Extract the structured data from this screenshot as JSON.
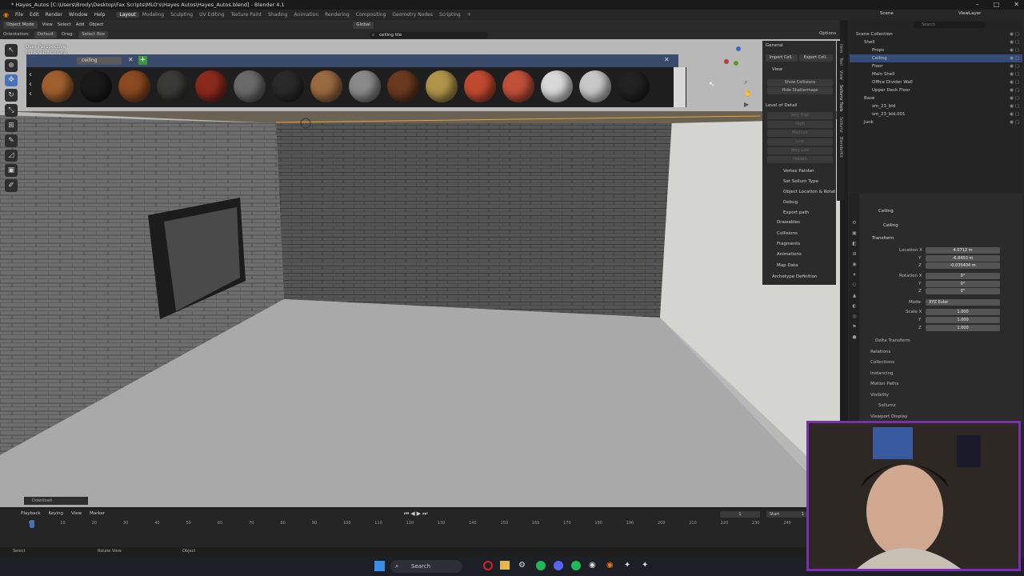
{
  "window": {
    "title": "* Hayes_Autos [C:\\Users\\Brody\\Desktop\\Fax Scripts\\MLO's\\Hayes Autos\\Hayes_Autos.blend] - Blender 4.1",
    "controls": [
      "–",
      "□",
      "✕"
    ]
  },
  "menubar": {
    "menus": [
      "File",
      "Edit",
      "Render",
      "Window",
      "Help"
    ],
    "workspaces": [
      "Layout",
      "Modeling",
      "Sculpting",
      "UV Editing",
      "Texture Paint",
      "Shading",
      "Animation",
      "Rendering",
      "Compositing",
      "Geometry Nodes",
      "Scripting"
    ],
    "active_workspace": "Layout",
    "add_tab": "+"
  },
  "header": {
    "mode": "Object Mode",
    "menus": [
      "View",
      "Select",
      "Add",
      "Object"
    ],
    "orientation_label": "Orientation:",
    "orientation_value": "Default",
    "drag_label": "Drag:",
    "drag_value": "Select Box",
    "transform": "Global",
    "options": "Options"
  },
  "search": {
    "value": "ceiling tile"
  },
  "viewport": {
    "perspective": "User Perspective",
    "collection": "(1) Shell | Ceiling",
    "palette_search": "ceiling",
    "download_label": "Download"
  },
  "materials": [
    {
      "name": "copper-ball",
      "color": "#a0602e"
    },
    {
      "name": "black-ball",
      "color": "#1a1a1a"
    },
    {
      "name": "rust-ball",
      "color": "#8a4a22"
    },
    {
      "name": "dark-metal-ball",
      "color": "#3a3a36"
    },
    {
      "name": "red-ball",
      "color": "#8a2a1c"
    },
    {
      "name": "gray-tile-ball",
      "color": "#6a6a6a"
    },
    {
      "name": "charcoal-ball",
      "color": "#2a2a2a"
    },
    {
      "name": "wood-slat-ball",
      "color": "#9a6a40"
    },
    {
      "name": "gray-panel-ball",
      "color": "#8a8a8a"
    },
    {
      "name": "brown-wood-ball",
      "color": "#6a3a20"
    },
    {
      "name": "gold-hex-ball",
      "color": "#b0944a"
    },
    {
      "name": "red-brick-ball",
      "color": "#c04a30"
    },
    {
      "name": "red-tile-ball",
      "color": "#c0503a"
    },
    {
      "name": "white-ball",
      "color": "#d8d8d8"
    },
    {
      "name": "white-hex-ball",
      "color": "#c8c8c8"
    },
    {
      "name": "black-gloss-ball",
      "color": "#222222"
    }
  ],
  "npanel": {
    "general": "General",
    "import_btn": "Import Coll..",
    "export_btn": "Export Coll..",
    "view": "View",
    "show_collisions": "Show Collisions",
    "hide_shattermaps": "Hide Shattermaps",
    "lod": "Level of Detail",
    "lod_items": [
      "Very High",
      "High",
      "Medium",
      "Low",
      "Very Low",
      "Hidden"
    ],
    "subpanels": [
      "Vertex Painter",
      "Set Sollum Type",
      "Object Location & Rotat..",
      "Debug",
      "Export path"
    ],
    "sections": [
      "Drawables",
      "Collisions",
      "Fragments",
      "Animations",
      "Map Data",
      "Archetype Definition"
    ],
    "tabs": [
      "Item",
      "Tool",
      "View",
      "Sollumz Tools",
      "Sollumz",
      "BlenderKit"
    ]
  },
  "outliner": {
    "search_placeholder": "Search",
    "scene": "Scene",
    "viewlayer": "ViewLayer",
    "items": [
      {
        "label": "Scene Collection",
        "indent": 0
      },
      {
        "label": "Shell",
        "indent": 1
      },
      {
        "label": "Props",
        "indent": 2
      },
      {
        "label": "Ceiling",
        "indent": 2
      },
      {
        "label": "Floor",
        "indent": 2
      },
      {
        "label": "Main Shell",
        "indent": 2
      },
      {
        "label": "Office Divider Wall",
        "indent": 2
      },
      {
        "label": "Upper Deck Floor",
        "indent": 2
      },
      {
        "label": "Base",
        "indent": 1
      },
      {
        "label": "sm_23_bld",
        "indent": 2
      },
      {
        "label": "sm_23_bld.001",
        "indent": 2
      },
      {
        "label": "Junk",
        "indent": 1
      }
    ]
  },
  "properties": {
    "object": "Ceiling",
    "object_name": "Ceiling",
    "transform": "Transform",
    "location_label": "Location X",
    "loc_x": "4.0712 m",
    "loc_y": "-6.8453 m",
    "loc_z": "-0.035404 m",
    "rotation_label": "Rotation X",
    "rot_x": "0°",
    "rot_y": "0°",
    "rot_z": "0°",
    "mode_label": "Mode",
    "mode_value": "XYZ Euler",
    "scale_label": "Scale X",
    "scale_x": "1.000",
    "scale_y": "1.000",
    "scale_z": "1.000",
    "y": "Y",
    "z": "Z",
    "sections": [
      "Delta Transform",
      "Relations",
      "Collections",
      "Instancing",
      "Motion Paths",
      "Visibility",
      "Sollumz",
      "Viewport Display"
    ]
  },
  "timeline": {
    "menus": [
      "Playback",
      "Keying",
      "View",
      "Marker"
    ],
    "current_frame": "1",
    "start_label": "Start",
    "start": "1",
    "ticks": [
      "0",
      "10",
      "20",
      "30",
      "40",
      "50",
      "60",
      "70",
      "80",
      "90",
      "100",
      "110",
      "120",
      "130",
      "140",
      "150",
      "160",
      "170",
      "180",
      "190",
      "200",
      "210",
      "220",
      "230",
      "240"
    ]
  },
  "statusbar": {
    "select": "Select",
    "rotate": "Rotate View",
    "object": "Object"
  },
  "taskbar": {
    "search": "Search"
  }
}
